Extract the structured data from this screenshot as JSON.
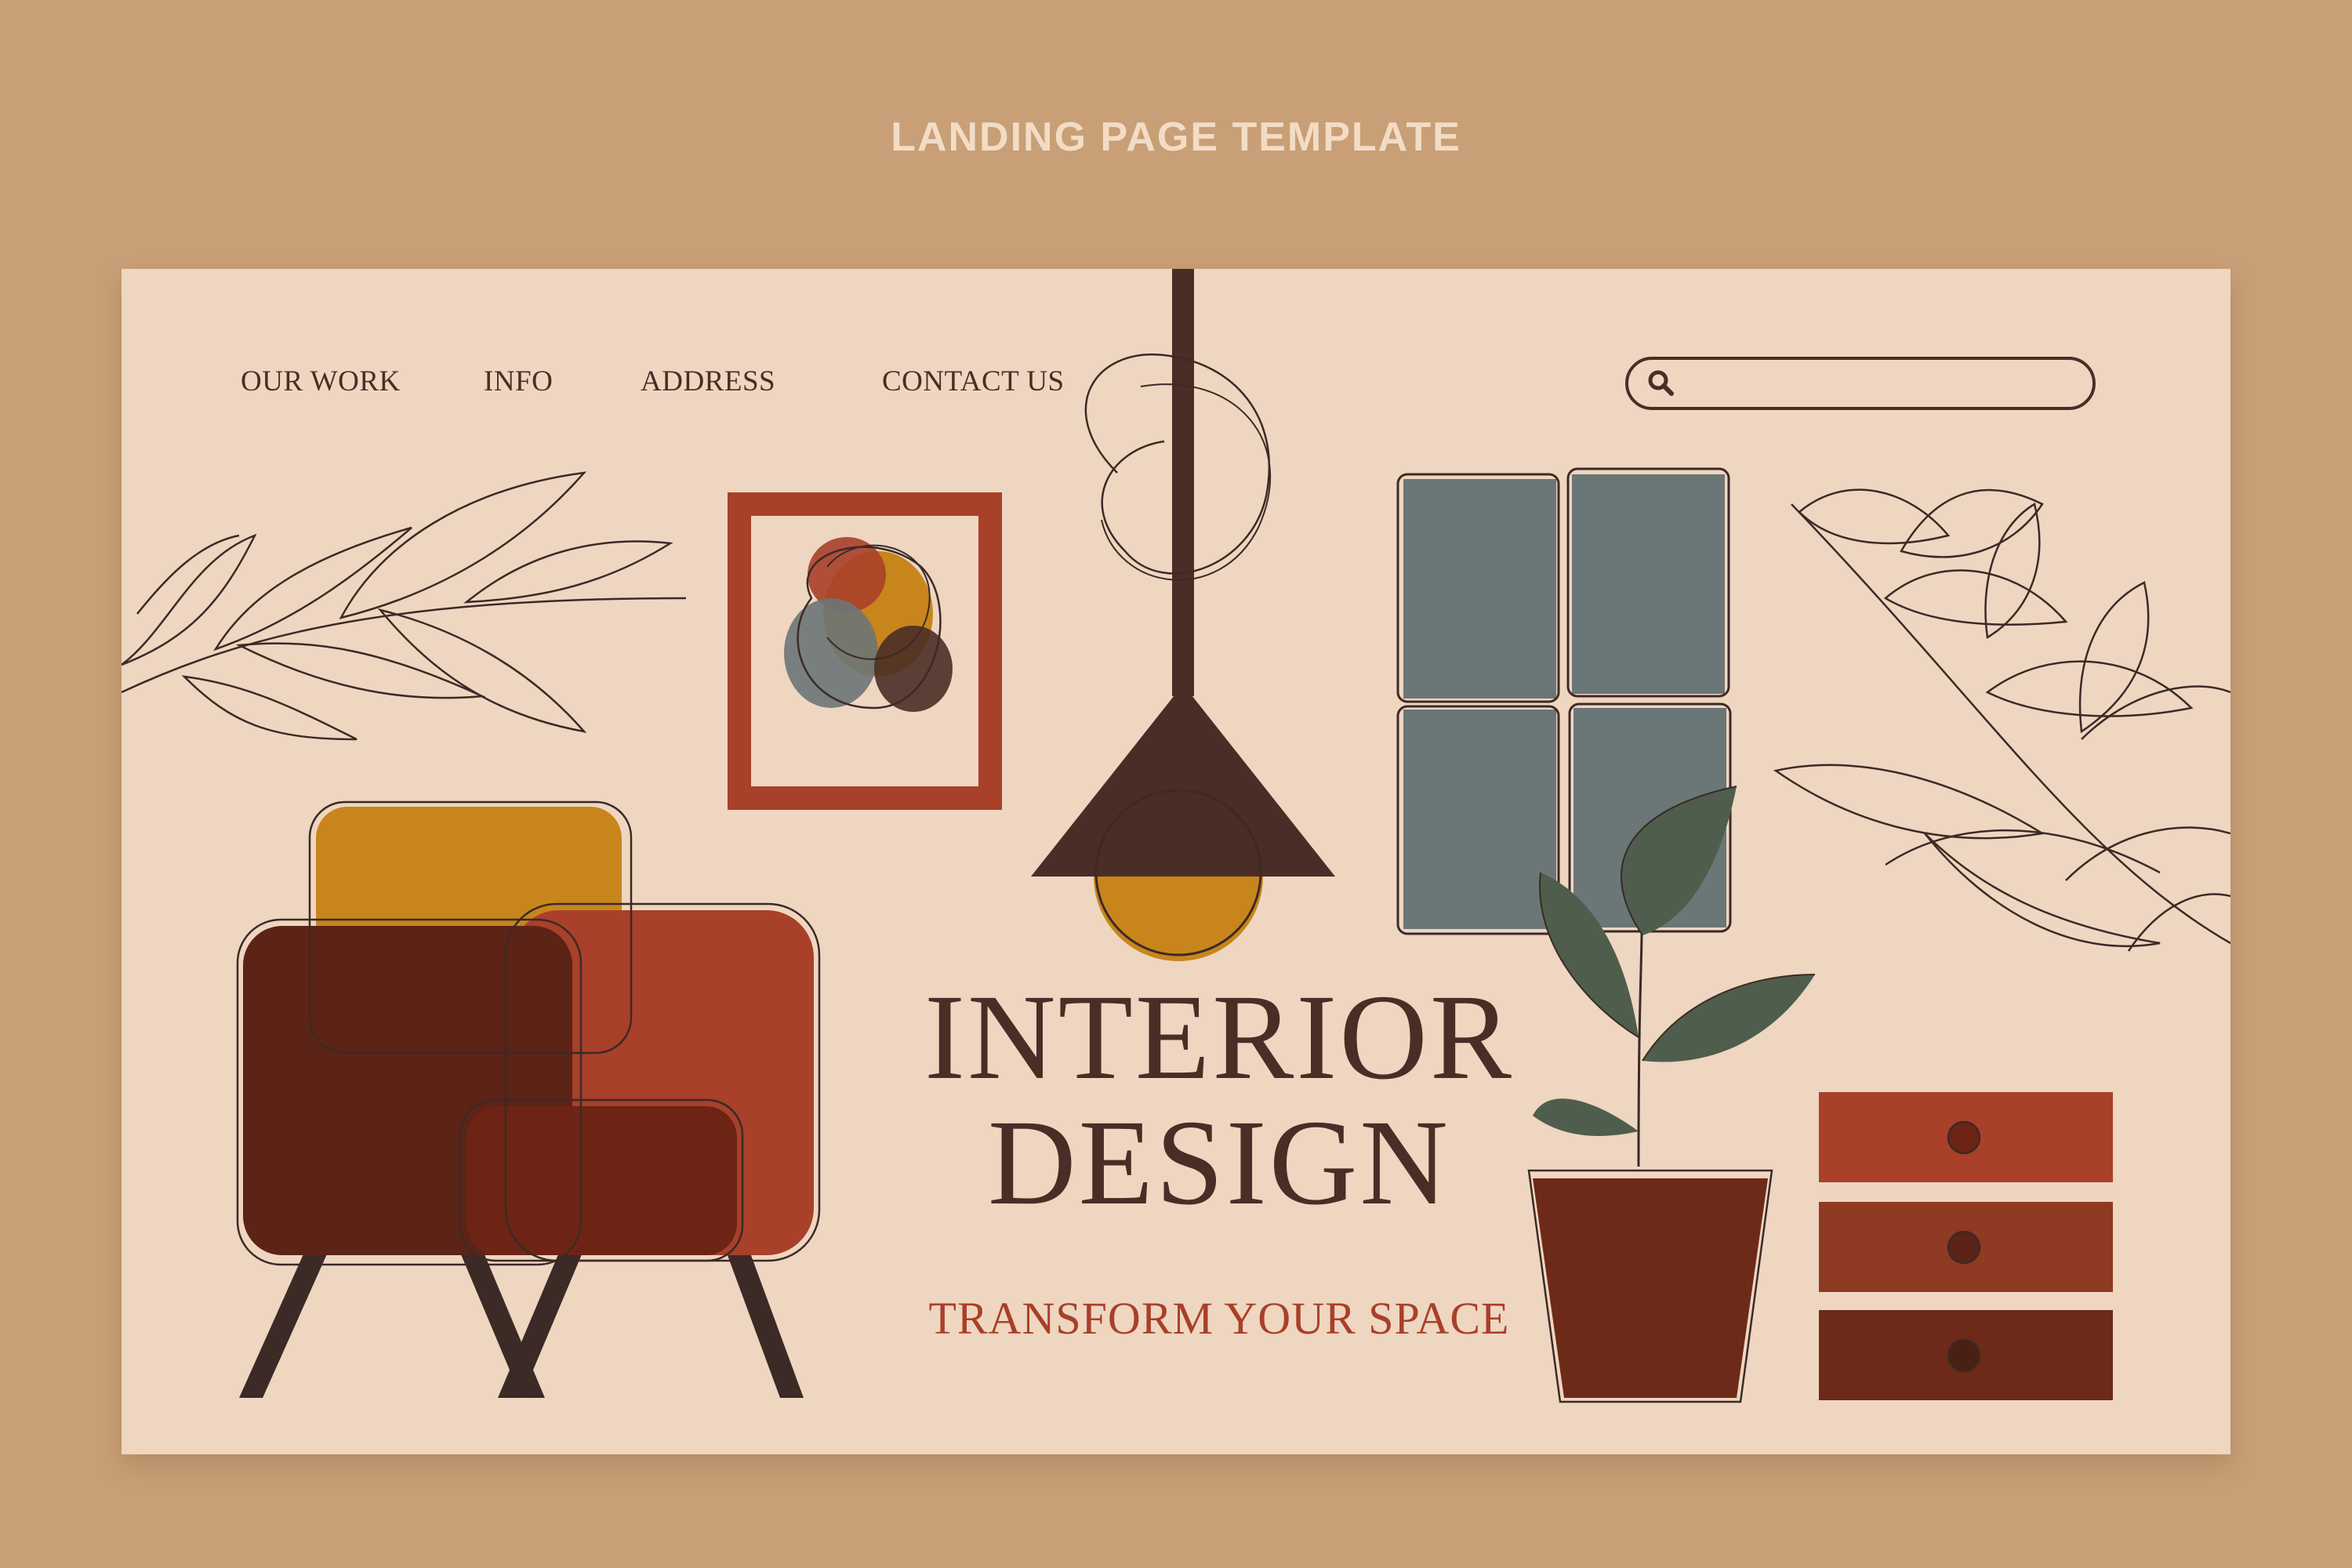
{
  "header": {
    "title": "LANDING PAGE TEMPLATE"
  },
  "nav": {
    "items": [
      {
        "label": "OUR WORK"
      },
      {
        "label": "INFO"
      },
      {
        "label": "ADDRESS"
      },
      {
        "label": "CONTACT US"
      }
    ]
  },
  "search": {
    "value": "",
    "placeholder": "",
    "icon": "search-icon"
  },
  "hero": {
    "title_line1": "INTERIOR",
    "title_line2": "DESIGN",
    "tagline": "TRANSFORM YOUR SPACE"
  },
  "colors": {
    "background": "#c89f76",
    "card": "#efd6c1",
    "ink": "#4a2d26",
    "accent": "#a8402a",
    "mustard": "#c8851c",
    "slate": "#6b7677",
    "leaf": "#4f5e4c"
  },
  "illustrations": [
    "branch-left-illustration",
    "framed-art-illustration",
    "pendant-lamp-illustration",
    "window-illustration",
    "branch-right-illustration",
    "armchair-illustration",
    "potted-plant-illustration",
    "dresser-illustration"
  ]
}
